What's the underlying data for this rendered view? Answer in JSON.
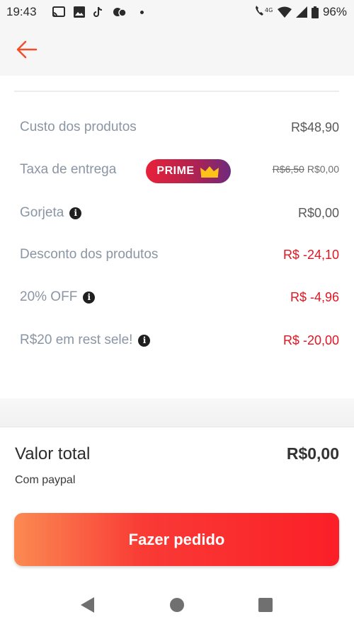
{
  "status_bar": {
    "time": "19:43",
    "network": "4G",
    "battery": "96%",
    "icons": [
      "cast-icon",
      "gallery-icon",
      "tiktok-icon",
      "app-notification-icon",
      "dot-icon",
      "wifi-call-icon",
      "wifi-icon",
      "signal-icon",
      "battery-icon"
    ]
  },
  "header": {
    "back_icon": "arrow-left-icon",
    "accent": "#f04f2a"
  },
  "summary": {
    "products_cost": {
      "label": "Custo dos produtos",
      "value": "R$48,90"
    },
    "delivery_fee": {
      "label": "Taxa de entrega",
      "badge": "PRIME",
      "old_value": "R$6,50",
      "value": "R$0,00"
    },
    "tip": {
      "label": "Gorjeta",
      "value": "R$0,00"
    },
    "products_discount": {
      "label": "Desconto dos produtos",
      "value": "R$ -24,10"
    },
    "percent_off": {
      "label": "20% OFF",
      "value": "R$ -4,96"
    },
    "rest_promo": {
      "label": "R$20 em rest sele!",
      "value": "R$ -20,00"
    }
  },
  "total": {
    "label": "Valor total",
    "value": "R$0,00",
    "payment": "Com paypal"
  },
  "order_button": {
    "label": "Fazer pedido"
  },
  "colors": {
    "discount": "#e01622",
    "button_start": "#fb8a52",
    "button_end": "#fb1f27"
  }
}
